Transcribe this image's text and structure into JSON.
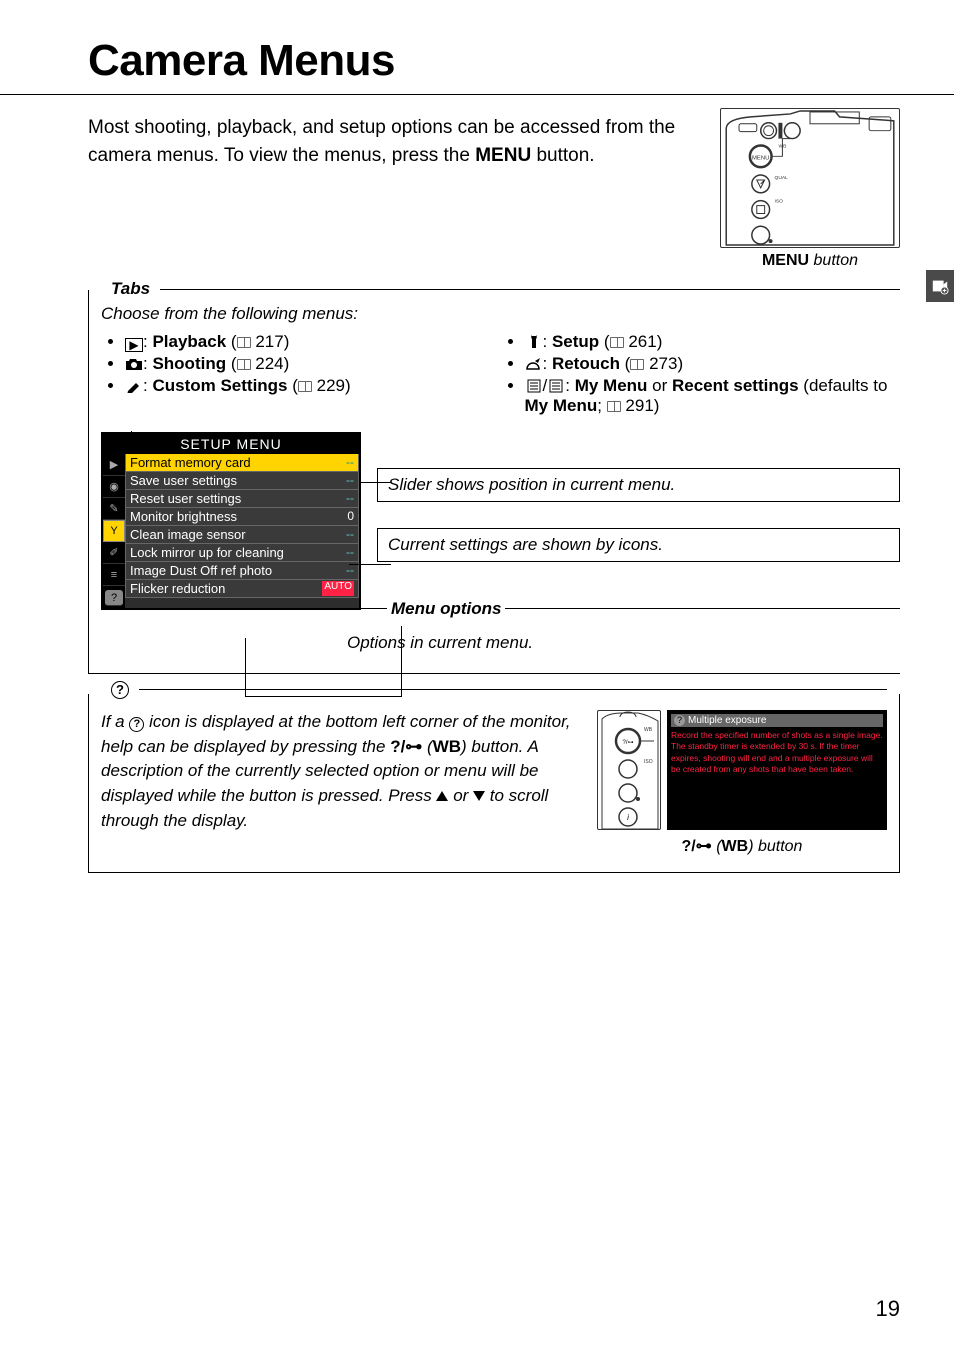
{
  "title": "Camera Menus",
  "intro": "Most shooting, playback, and setup options can be accessed from the camera menus.  To view the menus, press the ",
  "intro_button": "MENU",
  "intro_suffix": " button.",
  "menu_button_caption_prefix": "MENU",
  "menu_button_caption_suffix": " button",
  "tabs": {
    "heading": "Tabs",
    "desc": "Choose from the following menus:",
    "left": [
      {
        "name": "Playback",
        "page": "217",
        "icon": "play"
      },
      {
        "name": "Shooting",
        "page": "224",
        "icon": "camera"
      },
      {
        "name": "Custom Settings",
        "page": "229",
        "icon": "pencil"
      }
    ],
    "right": [
      {
        "name": "Setup",
        "page": "261",
        "icon": "wrench"
      },
      {
        "name": "Retouch",
        "page": "273",
        "icon": "palette"
      },
      {
        "name_pre": "My Menu",
        "name_mid": " or ",
        "name2": "Recent settings",
        "suffix": " (defaults to ",
        "name3": "My Menu",
        "page": "291",
        "icon": "list"
      }
    ]
  },
  "setup_menu": {
    "title": "SETUP MENU",
    "items": [
      {
        "label": "Format memory card",
        "value": "--",
        "hl": true
      },
      {
        "label": "Save user settings",
        "value": "--"
      },
      {
        "label": "Reset user settings",
        "value": "--"
      },
      {
        "label": "Monitor brightness",
        "value": "0",
        "num": true
      },
      {
        "label": "Clean image sensor",
        "value": "--"
      },
      {
        "label": "Lock mirror up for cleaning",
        "value": "--"
      },
      {
        "label": "Image Dust Off ref photo",
        "value": "--"
      },
      {
        "label": "Flicker reduction",
        "value": "AUTO",
        "auto": true
      }
    ]
  },
  "annotations": {
    "slider": "Slider shows position in current menu.",
    "icons": "Current settings are shown by icons.",
    "menu_options_label": "Menu options",
    "menu_options_desc": "Options in current menu."
  },
  "help": {
    "icon_label": "?",
    "text_1": "If a ",
    "text_2": " icon is displayed at the bottom left corner of the monitor, help can be displayed by pressing the ",
    "btn1": "?/",
    "btn2": "WB",
    "text_3": ") button.  A description of the currently selected option or menu will be displayed while the button is pressed.  Press ",
    "text_4": " or ",
    "text_5": " to scroll through the display.",
    "popup_title": "Multiple exposure",
    "popup_body": "Record the specified number of shots as a single image. The standby timer is extended by 30 s. If the timer expires, shooting will end and a multiple exposure will be created from any shots that have been taken.",
    "caption_btn": "?/",
    "caption_wb": "WB",
    "caption_suffix": ") button"
  },
  "page_number": "19"
}
